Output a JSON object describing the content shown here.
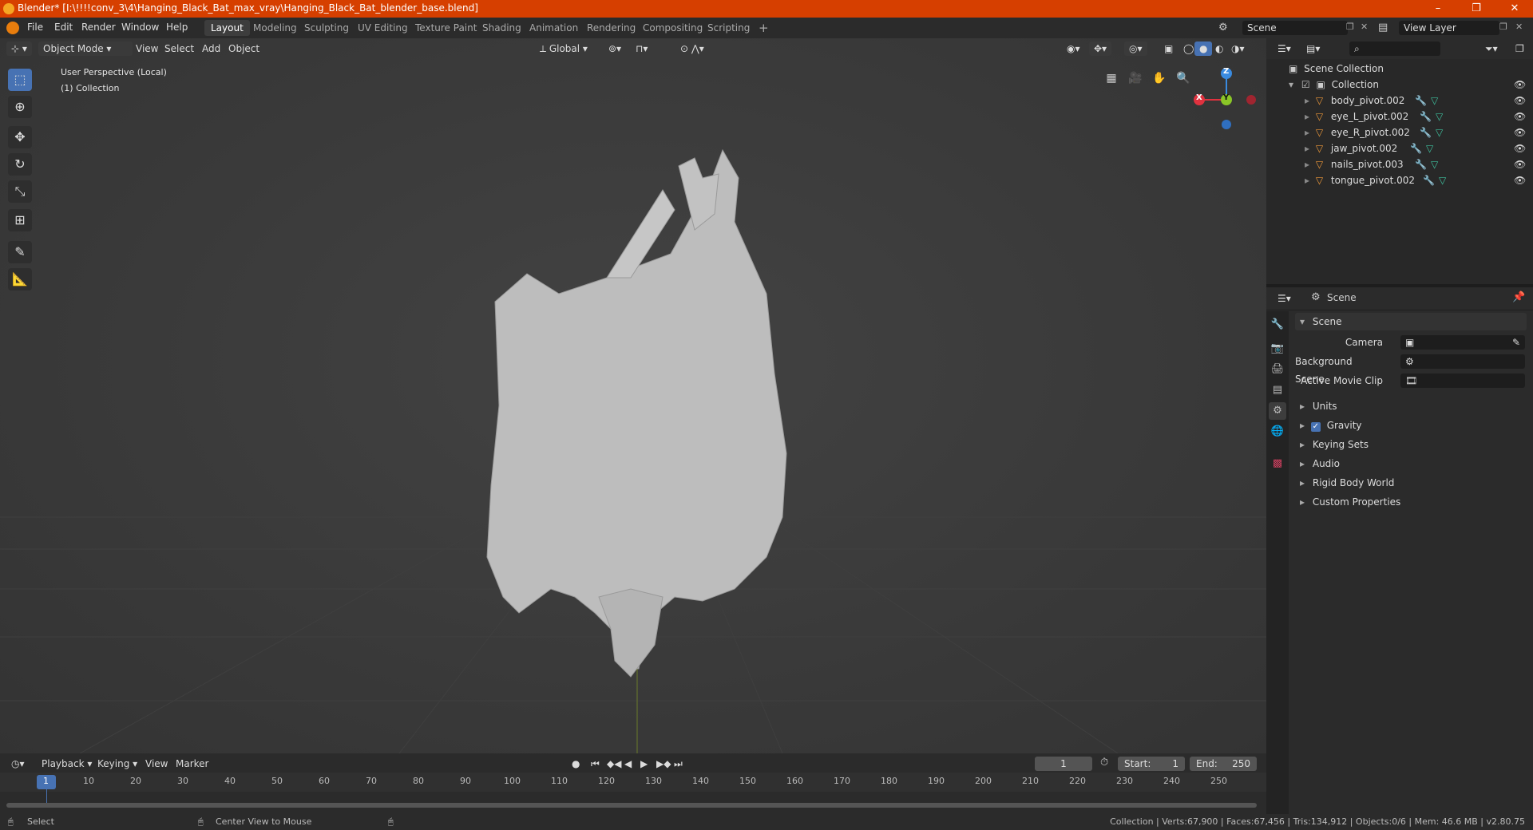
{
  "window": {
    "title": "Blender* [I:\\!!!!conv_3\\4\\Hanging_Black_Bat_max_vray\\Hanging_Black_Bat_blender_base.blend]",
    "minimize": "–",
    "maximize": "❐",
    "close": "✕"
  },
  "menubar": {
    "items": [
      "File",
      "Edit",
      "Render",
      "Window",
      "Help"
    ],
    "workspaces": [
      "Layout",
      "Modeling",
      "Sculpting",
      "UV Editing",
      "Texture Paint",
      "Shading",
      "Animation",
      "Rendering",
      "Compositing",
      "Scripting"
    ],
    "add_tab": "+",
    "scene_name": "Scene",
    "view_layer": "View Layer"
  },
  "viewport": {
    "mode": "Object Mode",
    "menus": [
      "View",
      "Select",
      "Add",
      "Object"
    ],
    "transform_orientation": "Global",
    "overlay_line1": "User Perspective (Local)",
    "overlay_line2": "(1) Collection",
    "gizmo": {
      "x": "X",
      "y": "Y",
      "z": "Z"
    }
  },
  "outliner": {
    "root": "Scene Collection",
    "collection": "Collection",
    "objects": [
      "body_pivot.002",
      "eye_L_pivot.002",
      "eye_R_pivot.002",
      "jaw_pivot.002",
      "nails_pivot.003",
      "tongue_pivot.002"
    ]
  },
  "properties": {
    "header": "Scene",
    "panel_title": "Scene",
    "camera_label": "Camera",
    "background_scene_label": "Background Scene",
    "active_movie_clip_label": "Active Movie Clip",
    "subpanels": [
      "Units",
      "Gravity",
      "Keying Sets",
      "Audio",
      "Rigid Body World",
      "Custom Properties"
    ],
    "gravity_checked": true
  },
  "timeline": {
    "menus": [
      "Playback",
      "Keying",
      "View",
      "Marker"
    ],
    "current_frame": "1",
    "start_label": "Start:",
    "start_value": "1",
    "end_label": "End:",
    "end_value": "250",
    "ticks": [
      "1",
      "10",
      "20",
      "30",
      "40",
      "50",
      "60",
      "70",
      "80",
      "90",
      "100",
      "110",
      "120",
      "130",
      "140",
      "150",
      "160",
      "170",
      "180",
      "190",
      "200",
      "210",
      "220",
      "230",
      "240",
      "250"
    ]
  },
  "statusbar": {
    "left_action": "Select",
    "middle_action": "Center View to Mouse",
    "stats": "Collection | Verts:67,900 | Faces:67,456 | Tris:134,912 | Objects:0/6 | Mem: 46.6 MB | v2.80.75"
  },
  "colors": {
    "titlebar": "#d63f00",
    "accent": "#4772b3",
    "axis_x": "#e0323f",
    "axis_y": "#8ac627",
    "axis_z": "#3a8be0"
  }
}
